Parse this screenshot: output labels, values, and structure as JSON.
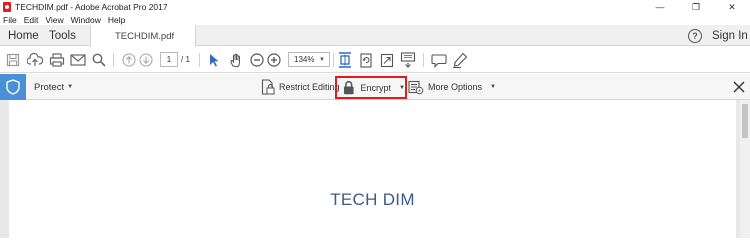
{
  "window": {
    "title": "TECHDIM.pdf - Adobe Acrobat Pro 2017",
    "minimize": "—",
    "maximize": "❐",
    "close": "✕"
  },
  "menu": [
    "File",
    "Edit",
    "View",
    "Window",
    "Help"
  ],
  "tabs": {
    "home": "Home",
    "tools": "Tools",
    "document": "TECHDIM.pdf"
  },
  "header": {
    "help": "?",
    "signin": "Sign In"
  },
  "toolbar": {
    "current_page": "1",
    "page_separator": "/",
    "total_pages": "1",
    "zoom": "134%",
    "icons": [
      "save-icon",
      "upload-icon",
      "print-icon",
      "email-icon",
      "search-icon",
      "prev-page-icon",
      "next-page-icon",
      "select-arrow-icon",
      "hand-icon",
      "zoom-out-icon",
      "zoom-in-icon",
      "fit-page-icon",
      "rotate-icon",
      "fullscreen-icon",
      "scroll-mode-icon",
      "comment-icon",
      "sign-icon"
    ]
  },
  "protect": {
    "label": "Protect",
    "restrict_editing": "Restrict Editing",
    "encrypt": "Encrypt",
    "more_options": "More Options",
    "accent": "#4a90d9",
    "highlight": "#e21b1b"
  },
  "document": {
    "heading": "TECH DIM"
  }
}
